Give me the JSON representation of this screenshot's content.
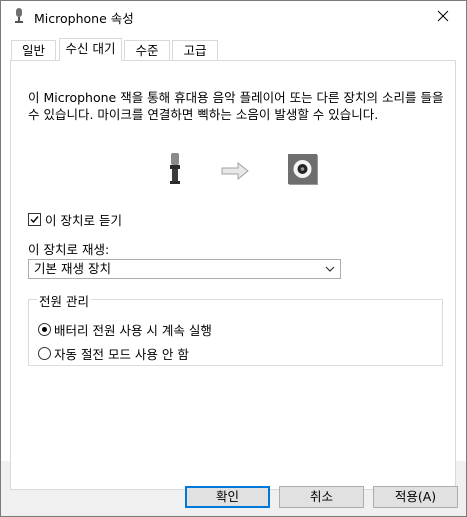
{
  "window": {
    "title": "Microphone 속성",
    "close_icon": "close-icon"
  },
  "tabs": [
    {
      "label": "일반",
      "active": false
    },
    {
      "label": "수신 대기",
      "active": true
    },
    {
      "label": "수준",
      "active": false
    },
    {
      "label": "고급",
      "active": false
    }
  ],
  "listen": {
    "description": "이 Microphone 잭을 통해 휴대용 음악 플레이어 또는 다른 장치의 소리를 들을 수 있습니다. 마이크를 연결하면 삑하는 소음이 발생할 수 있습니다.",
    "listen_checkbox_label": "이 장치로 듣기",
    "listen_checked": true,
    "playback_label": "이 장치로 재생:",
    "playback_value": "기본 재생 장치"
  },
  "power": {
    "group_title": "전원 관리",
    "options": [
      {
        "label": "배터리 전원 사용 시 계속 실행",
        "checked": true
      },
      {
        "label": "자동 절전 모드 사용 안 함",
        "checked": false
      }
    ]
  },
  "footer": {
    "ok_label": "확인",
    "cancel_label": "취소",
    "apply_label": "적용(A)"
  },
  "colors": {
    "accent": "#0078d7",
    "button_bg": "#e1e1e1",
    "window_bg": "#f0f0f0"
  }
}
